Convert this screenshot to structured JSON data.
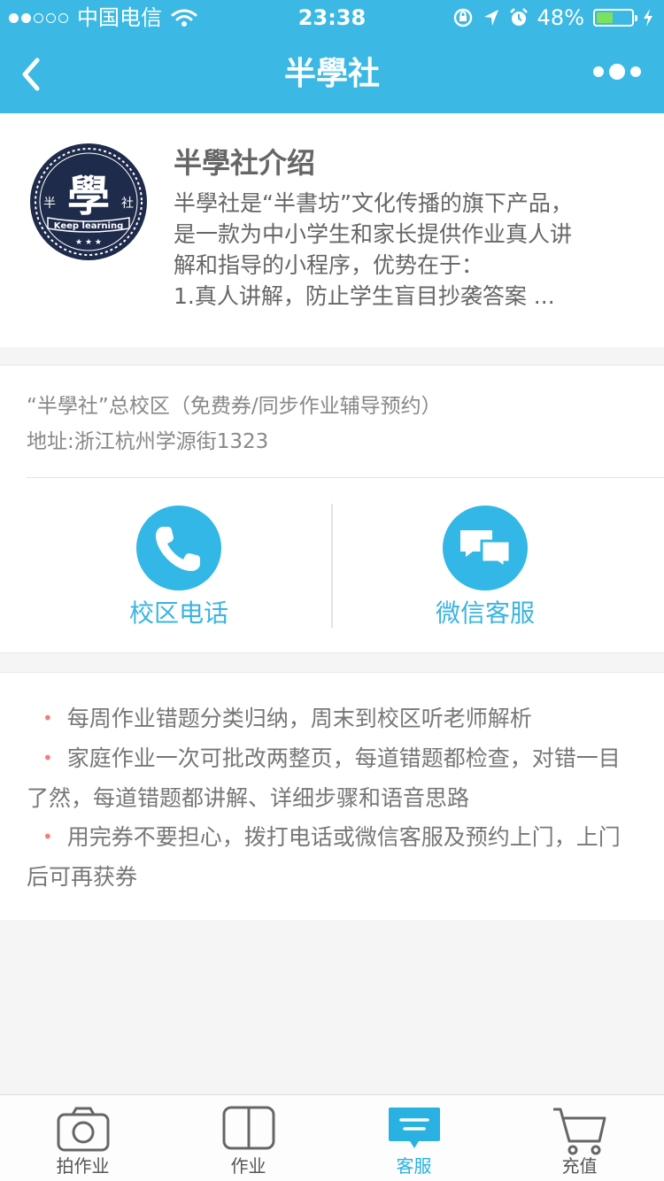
{
  "status_bar": {
    "carrier": "中国电信",
    "time": "23:38",
    "battery_percent": "48%",
    "battery_level": 0.48,
    "signal_bars_on": 2,
    "signal_bars_total": 5
  },
  "nav": {
    "title": "半學社"
  },
  "logo": {
    "main_char": "學",
    "left_char": "半",
    "right_char": "社",
    "ribbon": "Keep learning",
    "stars": "★ ★ ★"
  },
  "intro": {
    "title": "半學社介绍",
    "text": "半學社是“半書坊”文化传播的旗下产品，\n是一款为中小学生和家长提供作业真人讲\n解和指导的小程序，优势在于：\n1.真人讲解，防止学生盲目抄袭答案 ..."
  },
  "campus": {
    "name": "“半學社”总校区（免费券/同步作业辅导预约）",
    "address": "地址:浙江杭州学源街1323"
  },
  "actions": {
    "phone_label": "校区电话",
    "wechat_label": "微信客服"
  },
  "features": [
    "每周作业错题分类归纳，周末到校区听老师解析",
    "家庭作业一次可批改两整页，每道错题都检查，对错一目了然，每道错题都讲解、详细步骤和语音思路",
    "用完券不要担心，拨打电话或微信客服及预约上门，上门后可再获券"
  ],
  "bullet_char": "•",
  "tabs": [
    {
      "label": "拍作业",
      "icon": "camera-icon"
    },
    {
      "label": "作业",
      "icon": "book-icon"
    },
    {
      "label": "客服",
      "icon": "chat-icon"
    },
    {
      "label": "充值",
      "icon": "cart-icon"
    }
  ],
  "colors": {
    "primary": "#3bb9e4",
    "accent_text": "#3ab4e2",
    "bullet": "#f07f7f",
    "battery": "#7ce15b"
  }
}
